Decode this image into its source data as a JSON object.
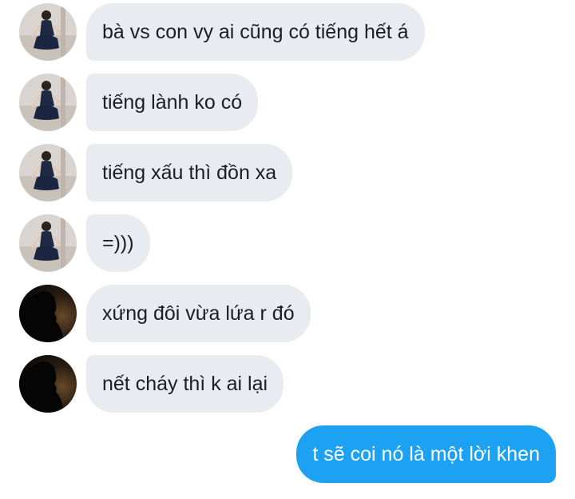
{
  "colors": {
    "received_bubble": "#e8ebef",
    "received_text": "#1c1e21",
    "sent_bubble": "#1da1f2",
    "sent_text": "#ffffff"
  },
  "messages": [
    {
      "direction": "received",
      "sender_avatar": "girl-photo-avatar",
      "text": "bà vs con vy ai cũng có tiếng hết á"
    },
    {
      "direction": "received",
      "sender_avatar": "girl-photo-avatar",
      "text": "tiếng lành ko có"
    },
    {
      "direction": "received",
      "sender_avatar": "girl-photo-avatar",
      "text": "tiếng xấu thì đồn xa"
    },
    {
      "direction": "received",
      "sender_avatar": "girl-photo-avatar",
      "text": "=)))"
    },
    {
      "direction": "received",
      "sender_avatar": "silhouette-avatar",
      "text": "xứng đôi vừa lứa r đó"
    },
    {
      "direction": "received",
      "sender_avatar": "silhouette-avatar",
      "text": "nết cháy thì k ai lại"
    },
    {
      "direction": "sent",
      "text": "t sẽ coi nó là một lời khen"
    }
  ]
}
